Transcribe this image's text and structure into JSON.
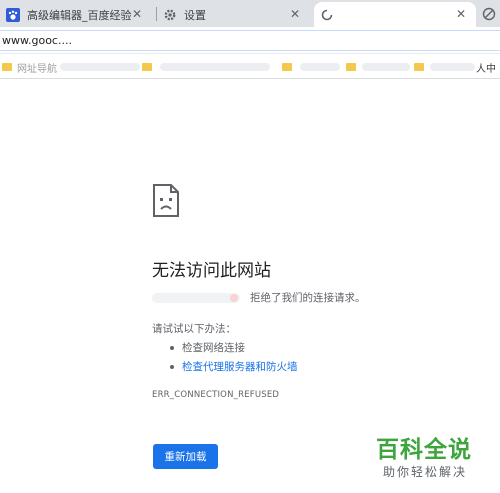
{
  "tabs": [
    {
      "title": "高级编辑器_百度经验",
      "favicon": "baidu-paw-icon",
      "active": false
    },
    {
      "title": "设置",
      "favicon": "gear-icon",
      "active": false
    },
    {
      "title": "",
      "favicon": "loading-spinner-icon",
      "active": true
    }
  ],
  "omnibox": {
    "url": "www.gooc...."
  },
  "bookmarks": [
    {
      "label": "网址导航",
      "icon": "folder-icon"
    },
    {
      "label": "人中",
      "icon": "folder-icon"
    }
  ],
  "error": {
    "title": "无法访问此网站",
    "description": "拒绝了我们的连接请求。",
    "try_label": "请试试以下办法：",
    "suggestions": [
      "检查网络连接",
      "检查代理服务器和防火墙"
    ],
    "code": "ERR_CONNECTION_REFUSED",
    "reload_label": "重新加载"
  },
  "watermark": {
    "brand": "百科全说",
    "tagline": "助你轻松解决"
  },
  "colors": {
    "accent": "#1a73e8",
    "link": "#1a73e8",
    "watermark": "#3da53b"
  }
}
